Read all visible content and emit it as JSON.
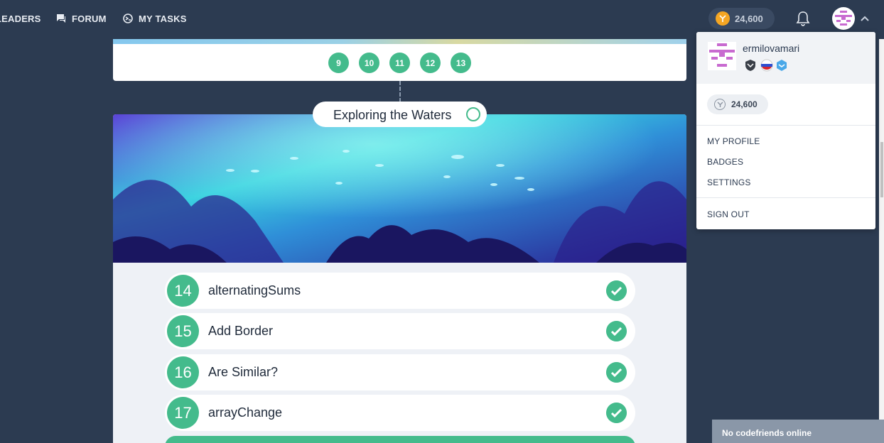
{
  "nav": {
    "items": [
      {
        "label": "LEADERS",
        "icon": "leaders-icon"
      },
      {
        "label": "FORUM",
        "icon": "forum-icon"
      },
      {
        "label": "MY TASKS",
        "icon": "tasks-icon"
      }
    ],
    "coins": "24,600",
    "coin_icon": "coin-icon",
    "accent": "#f5a623"
  },
  "levels": [
    "9",
    "10",
    "11",
    "12",
    "13"
  ],
  "chapter": {
    "title": "Exploring the Waters"
  },
  "tasks": [
    {
      "num": "14",
      "name": "alternatingSums",
      "done": true
    },
    {
      "num": "15",
      "name": "Add Border",
      "done": true
    },
    {
      "num": "16",
      "name": "Are Similar?",
      "done": true
    },
    {
      "num": "17",
      "name": "arrayChange",
      "done": true
    }
  ],
  "dropdown": {
    "username": "ermilovamari",
    "coins": "24,600",
    "links": [
      "MY PROFILE",
      "BADGES",
      "SETTINGS"
    ],
    "signout": "SIGN OUT"
  },
  "friends": {
    "status": "No codefriends online"
  },
  "colors": {
    "green": "#44bb8c",
    "bg": "#2c3b51",
    "panel": "#eef1f6"
  }
}
